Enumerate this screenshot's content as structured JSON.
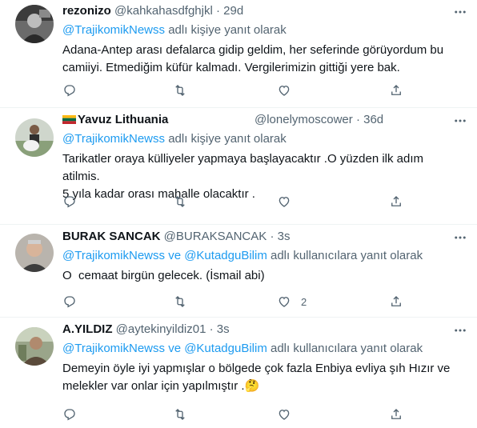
{
  "reply_prefix": "adlı kişiye yanıt olarak",
  "reply_prefix_multi": "adlı kullanıcılara yanıt olarak",
  "conjunction": "ve",
  "tweets": [
    {
      "name": "rezonizo",
      "handle": "@kahkahasdfghjkl",
      "time": "29d",
      "mentions": [
        "@TrajikomikNewss"
      ],
      "lines": [
        "Adana-Antep arası defalarca gidip geldim, her seferinde görüyordum bu",
        "camiiyi. Etmediğim küfür kalmadı. Vergilerimizin gittiği yere bak."
      ],
      "like_count": ""
    },
    {
      "name": "Yavuz Lithuania",
      "handle": "@lonelymoscower",
      "time": "36d",
      "flag": "Lithuania",
      "mentions": [
        "@TrajikomikNewss"
      ],
      "lines": [
        "Tarikatler oraya külliyeler yapmaya başlayacaktır .O yüzden ilk adım atilmis.",
        "5 yıla kadar orası mahalle olacaktır ."
      ],
      "like_count": ""
    },
    {
      "name": "BURAK SANCAK",
      "handle": "@BURAKSANCAK",
      "time": "3s",
      "mentions": [
        "@TrajikomikNewss",
        "@KutadguBilim"
      ],
      "lines": [
        "O  cemaat birgün gelecek. (İsmail abi)"
      ],
      "like_count": "2"
    },
    {
      "name": "A.YILDIZ",
      "handle": "@aytekinyildiz01",
      "time": "3s",
      "mentions": [
        "@TrajikomikNewss",
        "@KutadguBilim"
      ],
      "lines": [
        "Demeyin öyle iyi yapmışlar o bölgede çok fazla Enbiya evliya şıh Hızır ve",
        "melekler var onlar için yapılmıştır .🤔"
      ],
      "like_count": ""
    }
  ],
  "colors": {
    "accent": "#1d9bf0",
    "secondary_text": "#536471",
    "divider": "#eff3f4"
  },
  "icons": [
    "more-icon",
    "reply-icon",
    "retweet-icon",
    "like-icon",
    "share-icon",
    "lithuania-flag-icon"
  ]
}
